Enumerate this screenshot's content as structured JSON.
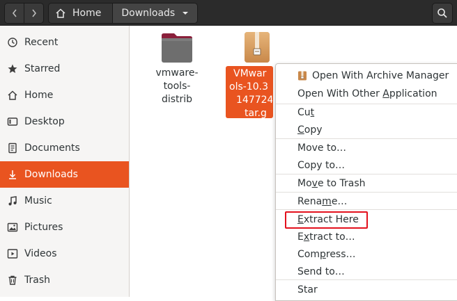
{
  "header": {
    "breadcrumb_home": "Home",
    "breadcrumb_current": "Downloads"
  },
  "sidebar": {
    "items": [
      {
        "label": "Recent",
        "icon": "clock-icon"
      },
      {
        "label": "Starred",
        "icon": "star-icon"
      },
      {
        "label": "Home",
        "icon": "home-icon"
      },
      {
        "label": "Desktop",
        "icon": "desktop-icon"
      },
      {
        "label": "Documents",
        "icon": "document-icon"
      },
      {
        "label": "Downloads",
        "icon": "download-icon",
        "active": true
      },
      {
        "label": "Music",
        "icon": "music-icon"
      },
      {
        "label": "Pictures",
        "icon": "picture-icon"
      },
      {
        "label": "Videos",
        "icon": "video-icon"
      },
      {
        "label": "Trash",
        "icon": "trash-icon"
      }
    ]
  },
  "files": [
    {
      "name_lines": [
        "vmware-",
        "tools-",
        "distrib"
      ],
      "type": "folder"
    },
    {
      "name_lines": [
        "VMwar",
        "ols-10.3",
        "147724",
        "tar.g"
      ],
      "type": "archive",
      "selected": true
    }
  ],
  "context_menu": {
    "items": [
      {
        "pre": "",
        "ul": "",
        "post": "Open With Archive Manager",
        "icon": "archive-manager-icon"
      },
      {
        "pre": "Open With Other ",
        "ul": "A",
        "post": "pplication"
      },
      {
        "pre": "Cu",
        "ul": "t",
        "post": ""
      },
      {
        "pre": "",
        "ul": "C",
        "post": "opy"
      },
      {
        "pre": "Move to…",
        "ul": "",
        "post": ""
      },
      {
        "pre": "Copy to…",
        "ul": "",
        "post": ""
      },
      {
        "pre": "Mo",
        "ul": "v",
        "post": "e to Trash"
      },
      {
        "pre": "Rena",
        "ul": "m",
        "post": "e…"
      },
      {
        "pre": "",
        "ul": "E",
        "post": "xtract Here"
      },
      {
        "pre": "E",
        "ul": "x",
        "post": "tract to…"
      },
      {
        "pre": "Com",
        "ul": "p",
        "post": "ress…"
      },
      {
        "pre": "Send to…",
        "ul": "",
        "post": ""
      },
      {
        "pre": "Star",
        "ul": "",
        "post": ""
      }
    ],
    "highlight_color": "#e3101c"
  },
  "colors": {
    "accent": "#e95420",
    "header_bg": "#2b2b2b",
    "sidebar_bg": "#f6f5f4"
  }
}
